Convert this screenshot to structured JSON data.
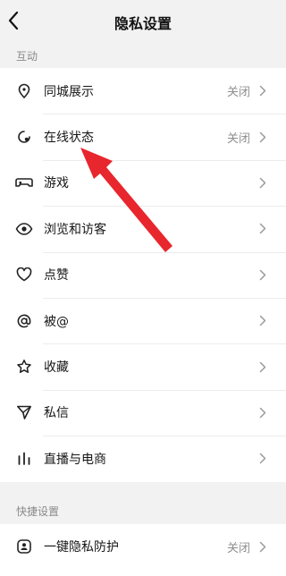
{
  "header": {
    "title": "隐私设置",
    "back_icon": "chevron-left-icon"
  },
  "sections": [
    {
      "label": "互动",
      "items": [
        {
          "label": "同城展示",
          "value": "关闭",
          "icon": "location-pin-icon"
        },
        {
          "label": "在线状态",
          "value": "关闭",
          "icon": "online-status-icon"
        },
        {
          "label": "游戏",
          "value": "",
          "icon": "game-controller-icon"
        },
        {
          "label": "浏览和访客",
          "value": "",
          "icon": "eye-icon"
        },
        {
          "label": "点赞",
          "value": "",
          "icon": "heart-icon"
        },
        {
          "label": "被@",
          "value": "",
          "icon": "at-sign-icon"
        },
        {
          "label": "收藏",
          "value": "",
          "icon": "star-icon"
        },
        {
          "label": "私信",
          "value": "",
          "icon": "send-icon"
        },
        {
          "label": "直播与电商",
          "value": "",
          "icon": "bar-chart-icon"
        }
      ]
    },
    {
      "label": "快捷设置",
      "items": [
        {
          "label": "一键隐私防护",
          "value": "关闭",
          "icon": "privacy-shield-icon"
        }
      ]
    }
  ],
  "annotation": {
    "icon": "red-arrow-pointer-icon",
    "color": "#e8262d",
    "target": "在线状态"
  }
}
